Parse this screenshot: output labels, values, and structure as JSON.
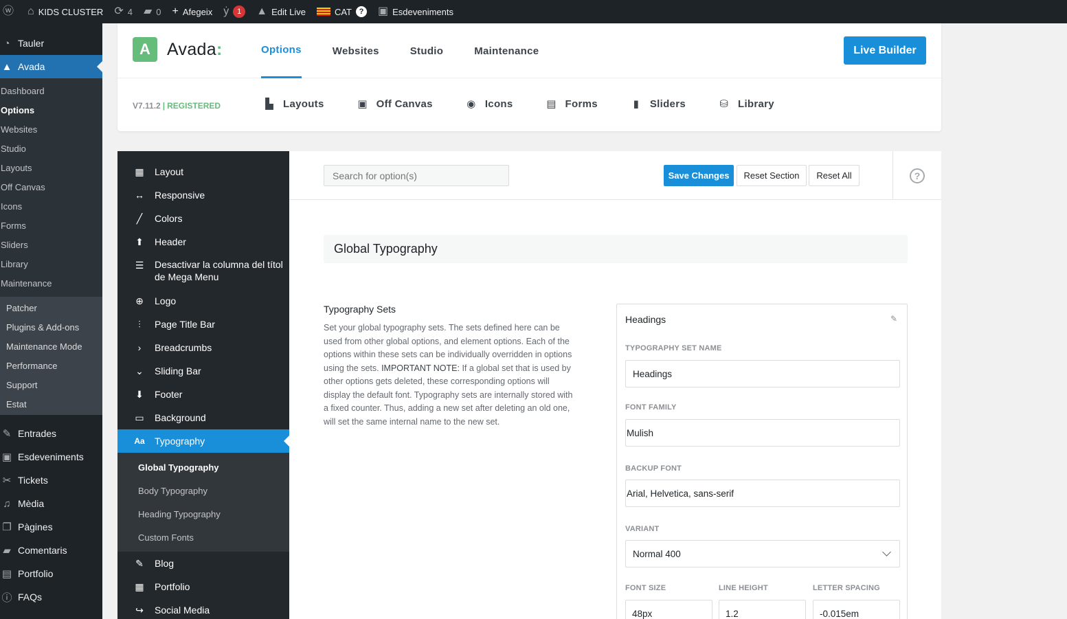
{
  "adminbar": {
    "site_name": "KIDS CLUSTER",
    "updates_count": "4",
    "comments_count": "0",
    "new_label": "Afegeix",
    "yoast_badge": "1",
    "edit_live_label": "Edit Live",
    "lang_label": "CAT",
    "events_label": "Esdeveniments"
  },
  "wpmenu": {
    "tauler": "Tauler",
    "avada": "Avada",
    "avada_sub": [
      "Dashboard",
      "Options",
      "Websites",
      "Studio",
      "Layouts",
      "Off Canvas",
      "Icons",
      "Forms",
      "Sliders",
      "Library",
      "Maintenance"
    ],
    "maint_sub": [
      "Patcher",
      "Plugins & Add-ons",
      "Maintenance Mode",
      "Performance",
      "Support",
      "Estat"
    ],
    "bottom": [
      "Entrades",
      "Esdeveniments",
      "Tickets",
      "Mèdia",
      "Pàgines",
      "Comentaris",
      "Portfolio",
      "FAQs"
    ]
  },
  "header": {
    "logo_text": "Avada",
    "logo_colon": ":",
    "logo_letter": "A",
    "nav": [
      "Options",
      "Websites",
      "Studio",
      "Maintenance"
    ],
    "live_builder": "Live Builder",
    "version": "V7.11.2",
    "version_sep": "|",
    "registered": "REGISTERED",
    "subnav": [
      "Layouts",
      "Off Canvas",
      "Icons",
      "Forms",
      "Sliders",
      "Library"
    ]
  },
  "options_menu": {
    "items": [
      "Layout",
      "Responsive",
      "Colors",
      "Header",
      "Desactivar la columna del títol de Mega Menu",
      "Logo",
      "Page Title Bar",
      "Breadcrumbs",
      "Sliding Bar",
      "Footer",
      "Background",
      "Typography"
    ],
    "typography_sub": [
      "Global Typography",
      "Body Typography",
      "Heading Typography",
      "Custom Fonts"
    ],
    "after": [
      "Blog",
      "Portfolio",
      "Social Media"
    ]
  },
  "toolbar": {
    "search_placeholder": "Search for option(s)",
    "save": "Save Changes",
    "reset_section": "Reset Section",
    "reset_all": "Reset All",
    "help": "?"
  },
  "section": {
    "title": "Global Typography",
    "desc_title": "Typography Sets",
    "desc_part1": "Set your global typography sets. The sets defined here can be used from other global options, and element options. Each of the options within these sets can be individually overridden in options using the sets. ",
    "desc_note": "IMPORTANT NOTE:",
    "desc_part2": " If a global set that is used by other options gets deleted, these corresponding options will display the default font. Typography sets are internally stored with a fixed counter. Thus, adding a new set after deleting an old one, will set the same internal name to the new set."
  },
  "typo_set": {
    "heading": "Headings",
    "name_label": "Typography Set Name",
    "name_value": "Headings",
    "family_label": "Font Family",
    "family_value": "Mulish",
    "backup_label": "Backup Font",
    "backup_value": "Arial, Helvetica, sans-serif",
    "variant_label": "Variant",
    "variant_value": "Normal 400",
    "size_label": "Font Size",
    "size_value": "48px",
    "lh_label": "Line Height",
    "lh_value": "1.2",
    "ls_label": "Letter Spacing",
    "ls_value": "-0.015em"
  }
}
